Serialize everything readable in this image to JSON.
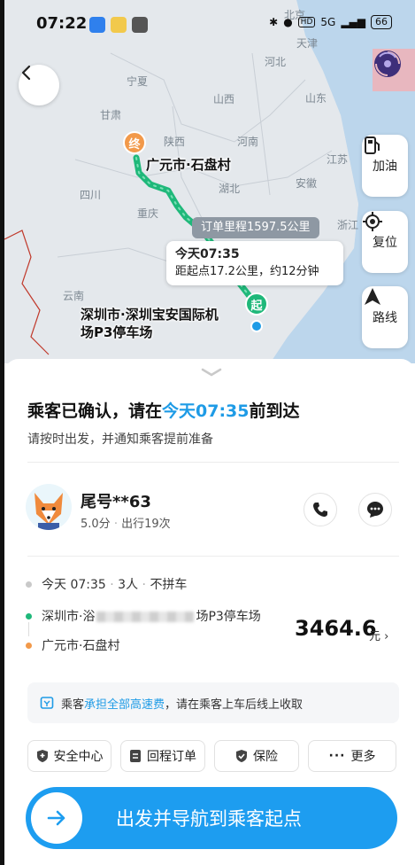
{
  "status_bar": {
    "time": "07:22",
    "network": "5G",
    "battery": "66"
  },
  "map": {
    "cities": [
      {
        "name": "北京"
      },
      {
        "name": "天津"
      },
      {
        "name": "宁夏"
      },
      {
        "name": "山西"
      },
      {
        "name": "河北"
      },
      {
        "name": "甘肃"
      },
      {
        "name": "山东"
      },
      {
        "name": "陕西"
      },
      {
        "name": "河南"
      },
      {
        "name": "江苏"
      },
      {
        "name": "四川"
      },
      {
        "name": "湖北"
      },
      {
        "name": "安徽"
      },
      {
        "name": "重庆"
      },
      {
        "name": "浙江"
      },
      {
        "name": "云南"
      }
    ],
    "end_marker": "终",
    "start_marker": "起",
    "destination_label": "广元市·石盘村",
    "origin_label_line1": "深圳市·深圳宝安国际机",
    "origin_label_line2": "场P3停车场",
    "mileage_tag": "订单里程1597.5公里",
    "eta_time": "今天07:35",
    "eta_detail": "距起点17.2公里，约12分钟",
    "side_buttons": {
      "fuel": "加油",
      "locate": "复位",
      "route": "路线"
    }
  },
  "order": {
    "title_prefix": "乘客已确认，请在",
    "title_time": "今天07:35",
    "title_suffix": "前到达",
    "subtitle": "请按时出发，并通知乘客提前准备"
  },
  "passenger": {
    "name": "尾号**63",
    "rating": "5.0分",
    "trips": "出行19次"
  },
  "trip": {
    "time": "今天 07:35",
    "seats": "3人",
    "carpool": "不拼车",
    "origin_prefix": "深圳市·浴",
    "origin_suffix": "场P3停车场",
    "destination": "广元市·石盘村",
    "price": "3464.6",
    "price_unit": "元"
  },
  "notice": {
    "prefix": "乘客",
    "highlight": "承担全部高速费",
    "suffix": "，请在乘客上车后线上收取"
  },
  "actions": {
    "safety": "安全中心",
    "return_order": "回程订单",
    "insurance": "保险",
    "more": "更多"
  },
  "main_button": "出发并导航到乘客起点",
  "colors": {
    "accent": "#1d9df0",
    "route": "#1fb87a",
    "end_pin": "#f2994a"
  }
}
